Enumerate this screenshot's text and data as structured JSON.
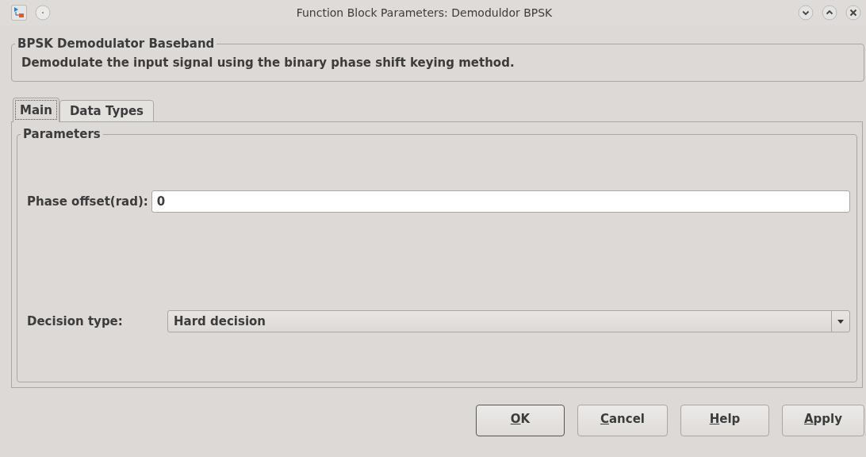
{
  "window": {
    "title": "Function Block Parameters: Demoduldor BPSK"
  },
  "description_group": {
    "title": "BPSK Demodulator Baseband",
    "text": "Demodulate the input signal using the binary phase shift keying method."
  },
  "tabs": [
    {
      "label": "Main",
      "selected": true
    },
    {
      "label": "Data Types",
      "selected": false
    }
  ],
  "parameters_group": {
    "title": "Parameters",
    "fields": [
      {
        "kind": "text",
        "label": "Phase offset(rad):",
        "value": "0"
      },
      {
        "kind": "dropdown",
        "label": "Decision type:",
        "value": "Hard decision"
      }
    ]
  },
  "buttons": [
    {
      "label": "OK",
      "default": true
    },
    {
      "label": "Cancel",
      "default": false
    },
    {
      "label": "Help",
      "default": false
    },
    {
      "label": "Apply",
      "default": false
    }
  ]
}
